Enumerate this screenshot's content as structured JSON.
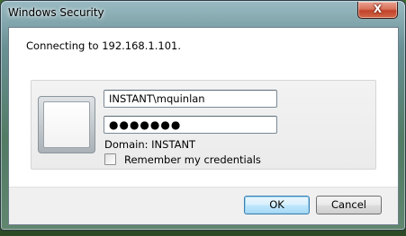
{
  "window": {
    "title": "Windows Security",
    "close_label": "X"
  },
  "dialog": {
    "connecting_text": "Connecting to 192.168.1.101."
  },
  "credentials": {
    "username_value": "INSTANT\\mquinlan",
    "password_mask": "●●●●●●●",
    "domain_text": "Domain: INSTANT",
    "remember_label": "Remember my credentials",
    "remember_checked": false
  },
  "buttons": {
    "ok_label": "OK",
    "cancel_label": "Cancel"
  },
  "icons": {
    "user_tile": "user-tile-icon",
    "close": "close-icon"
  }
}
